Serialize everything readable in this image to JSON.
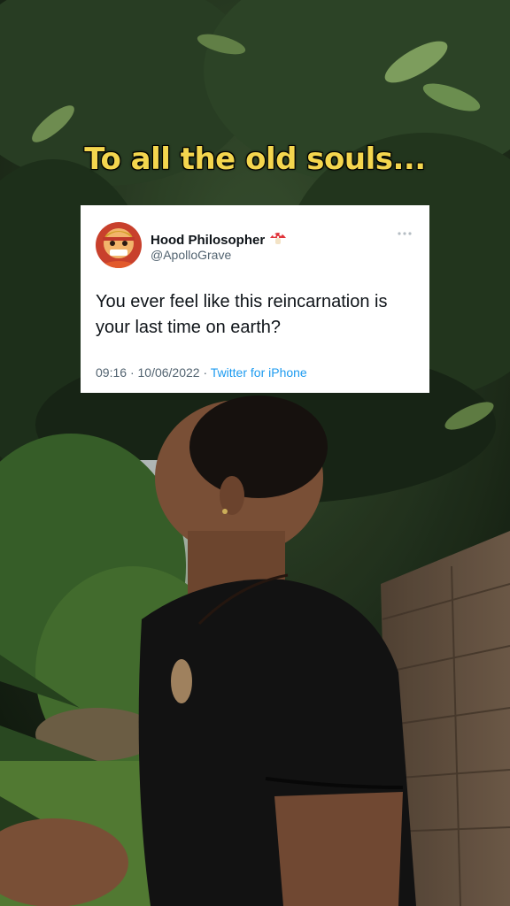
{
  "caption": "To all the old souls...",
  "tweet": {
    "display_name": "Hood Philosopher",
    "handle": "@ApolloGrave",
    "badge_icon": "mushroom-icon",
    "text": "You ever feel like this reincarnation is your last time on earth?",
    "time": "09:16",
    "date": "10/06/2022",
    "separator": "·",
    "source": "Twitter for iPhone"
  },
  "colors": {
    "caption": "#f4d64e",
    "twitter_blue": "#1d9bf0",
    "secondary_text": "#536471"
  }
}
